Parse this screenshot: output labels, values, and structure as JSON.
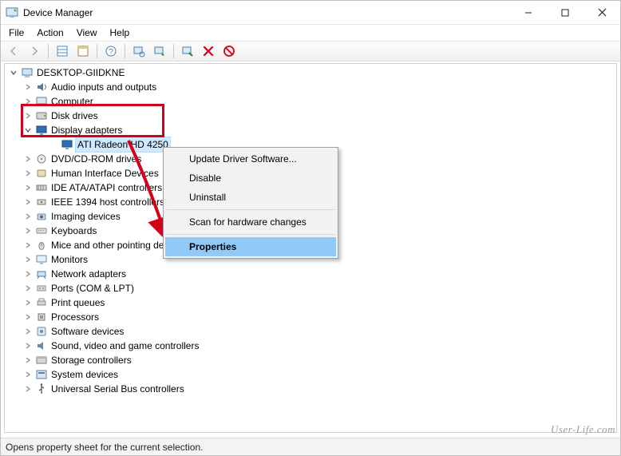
{
  "window": {
    "title": "Device Manager"
  },
  "menubar": {
    "items": [
      "File",
      "Action",
      "View",
      "Help"
    ]
  },
  "tree": {
    "root": {
      "label": "DESKTOP-GIIDKNE",
      "expanded": true
    },
    "categories": [
      {
        "label": "Audio inputs and outputs",
        "icon": "speaker"
      },
      {
        "label": "Computer",
        "icon": "monitor"
      },
      {
        "label": "Disk drives",
        "icon": "disk"
      },
      {
        "label": "Display adapters",
        "icon": "display",
        "expanded": true,
        "children": [
          {
            "label": "ATI Radeon HD 4250",
            "icon": "display",
            "selected": true
          }
        ]
      },
      {
        "label": "DVD/CD-ROM drives",
        "icon": "optical"
      },
      {
        "label": "Human Interface Devices",
        "icon": "hid"
      },
      {
        "label": "IDE ATA/ATAPI controllers",
        "icon": "ide"
      },
      {
        "label": "IEEE 1394 host controllers",
        "icon": "fw"
      },
      {
        "label": "Imaging devices",
        "icon": "camera"
      },
      {
        "label": "Keyboards",
        "icon": "keyboard"
      },
      {
        "label": "Mice and other pointing devices",
        "icon": "mouse"
      },
      {
        "label": "Monitors",
        "icon": "monitor2"
      },
      {
        "label": "Network adapters",
        "icon": "net"
      },
      {
        "label": "Ports (COM & LPT)",
        "icon": "port"
      },
      {
        "label": "Print queues",
        "icon": "printer"
      },
      {
        "label": "Processors",
        "icon": "cpu"
      },
      {
        "label": "Software devices",
        "icon": "soft"
      },
      {
        "label": "Sound, video and game controllers",
        "icon": "sound"
      },
      {
        "label": "Storage controllers",
        "icon": "storage"
      },
      {
        "label": "System devices",
        "icon": "system"
      },
      {
        "label": "Universal Serial Bus controllers",
        "icon": "usb"
      }
    ]
  },
  "context_menu": {
    "items": [
      {
        "label": "Update Driver Software...",
        "type": "item"
      },
      {
        "label": "Disable",
        "type": "item"
      },
      {
        "label": "Uninstall",
        "type": "item"
      },
      {
        "type": "sep"
      },
      {
        "label": "Scan for hardware changes",
        "type": "item"
      },
      {
        "type": "sep"
      },
      {
        "label": "Properties",
        "type": "item",
        "highlight": true
      }
    ]
  },
  "statusbar": {
    "text": "Opens property sheet for the current selection."
  },
  "watermark": {
    "text": "User-Life.com"
  }
}
